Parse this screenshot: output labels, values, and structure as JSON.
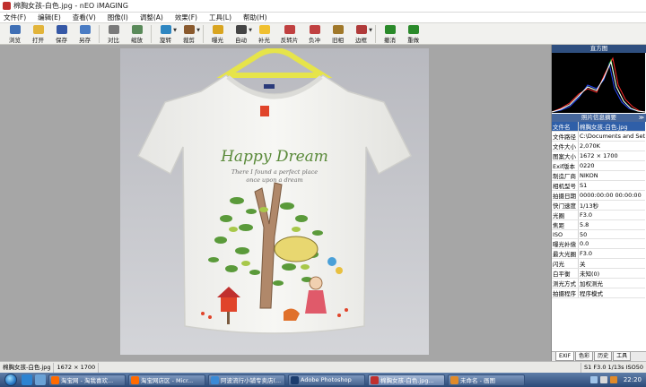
{
  "window": {
    "title": "棉胸女孩-白色.jpg - nEO iMAGING"
  },
  "menu": [
    "文件(F)",
    "编辑(E)",
    "查看(V)",
    "图像(I)",
    "调整(A)",
    "效果(F)",
    "工具(L)",
    "帮助(H)"
  ],
  "toolbar": [
    {
      "label": "浏览",
      "icon": "browse-icon",
      "color": "#3f6fb5"
    },
    {
      "label": "打开",
      "icon": "open-folder-icon",
      "color": "#e2b43a"
    },
    {
      "label": "保存",
      "icon": "save-disk-icon",
      "color": "#3558a6"
    },
    {
      "label": "另存",
      "icon": "save-as-icon",
      "color": "#4a7cc4"
    },
    {
      "label": "对比",
      "icon": "compare-icon",
      "color": "#7a7a7a"
    },
    {
      "label": "缩放",
      "icon": "zoom-icon",
      "color": "#5a8a5a"
    },
    {
      "label": "旋转",
      "icon": "rotate-icon",
      "color": "#2e86c1",
      "dropdown": true
    },
    {
      "label": "裁剪",
      "icon": "crop-icon",
      "color": "#8a5a2e",
      "dropdown": true
    },
    {
      "label": "曝光",
      "icon": "exposure-icon",
      "color": "#d9a520"
    },
    {
      "label": "自动",
      "icon": "auto-icon",
      "color": "#444444",
      "dropdown": true
    },
    {
      "label": "补光",
      "icon": "fill-light-icon",
      "color": "#f0c030"
    },
    {
      "label": "反转片",
      "icon": "slide-film-icon",
      "color": "#c04040"
    },
    {
      "label": "负冲",
      "icon": "cross-process-icon",
      "color": "#c04040"
    },
    {
      "label": "旧相",
      "icon": "old-photo-icon",
      "color": "#a0782a"
    },
    {
      "label": "边框",
      "icon": "frame-icon",
      "color": "#b03a3a",
      "dropdown": true
    },
    {
      "label": "撤消",
      "icon": "undo-icon",
      "color": "#2a8a2a"
    },
    {
      "label": "重做",
      "icon": "redo-icon",
      "color": "#2a8a2a"
    }
  ],
  "shirt": {
    "headline": "Happy Dream",
    "line1": "There I found a perfect place",
    "line2": "once upon a dream"
  },
  "panel": {
    "histogram_title": "直方图",
    "info_title": "照片信息摘要",
    "collapse_glyph": "≫",
    "rows": [
      {
        "k": "文件名",
        "v": "棉胸女孩-白色.jpg",
        "selected": true
      },
      {
        "k": "文件路径",
        "v": "C:\\Documents and Set"
      },
      {
        "k": "文件大小",
        "v": "2,070K"
      },
      {
        "k": "图案大小",
        "v": "1672 × 1700"
      },
      {
        "k": "Exif版本",
        "v": "0220"
      },
      {
        "k": "制造厂商",
        "v": "NIKON"
      },
      {
        "k": "相机型号",
        "v": "S1"
      },
      {
        "k": "拍摄日期",
        "v": "0000:00:00 00:00:00"
      },
      {
        "k": "快门速度",
        "v": "1/13秒"
      },
      {
        "k": "光圈",
        "v": "F3.0"
      },
      {
        "k": "焦距",
        "v": "5.8"
      },
      {
        "k": "ISO",
        "v": "50"
      },
      {
        "k": "曝光补偿",
        "v": "0.0"
      },
      {
        "k": "最大光圈",
        "v": "F3.0"
      },
      {
        "k": "闪光",
        "v": "关"
      },
      {
        "k": "白平衡",
        "v": "未知(0)"
      },
      {
        "k": "测光方式",
        "v": "加权测光"
      },
      {
        "k": "拍摄程序",
        "v": "程序模式"
      }
    ],
    "tabs": [
      "EXIF",
      "色彩",
      "历史",
      "工具"
    ]
  },
  "status": {
    "filename": "棉胸女孩-白色.jpg",
    "dimensions": "1672 × 1700",
    "exif": "S1 F3.0 1/13s ISO50"
  },
  "taskbar": {
    "tasks": [
      {
        "label": "淘宝网 - 淘我喜欢...",
        "color": "#ff6a00"
      },
      {
        "label": "淘宝网店区 - Micr...",
        "color": "#ff6a00"
      },
      {
        "label": "阿波流行小铺专卖店(...",
        "color": "#3a8ad6"
      },
      {
        "label": "Adobe Photoshop",
        "color": "#1c3d6e"
      },
      {
        "label": "棉胸女孩-白色.jpg...",
        "color": "#c0302e",
        "active": true
      },
      {
        "label": "未命名 - 画图",
        "color": "#e08a2a"
      }
    ],
    "clock": "22:20"
  }
}
